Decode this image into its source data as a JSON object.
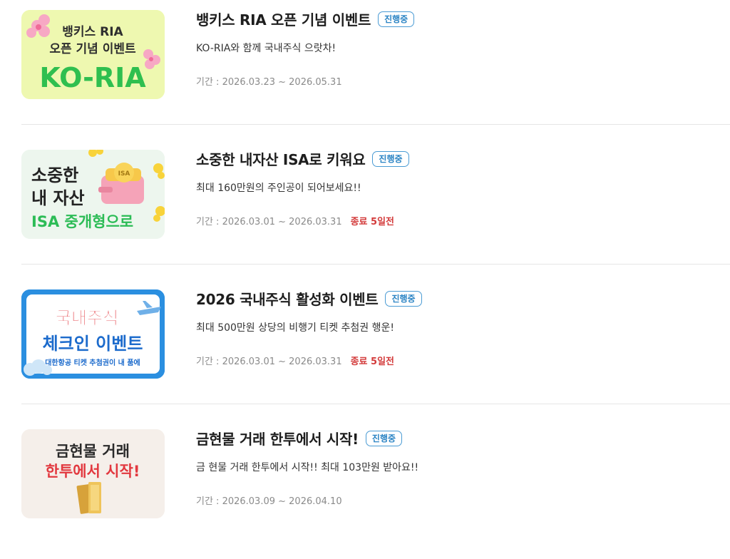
{
  "events": [
    {
      "title": "뱅키스 RIA 오픈 기념 이벤트",
      "badge": "진행중",
      "desc": "KO-RIA와 함께 국내주식 으랏차!",
      "period": "기간 : 2026.03.23 ~ 2026.05.31",
      "deadline": "",
      "thumb_lines": [
        "뱅키스 RIA",
        "오픈 기념 이벤트",
        "KO-RIA"
      ]
    },
    {
      "title": "소중한 내자산 ISA로 키워요",
      "badge": "진행중",
      "desc": "최대 160만원의 주인공이 되어보세요!!",
      "period": "기간 : 2026.03.01 ~ 2026.03.31",
      "deadline": "종료 5일전",
      "thumb_lines": [
        "소중한",
        "내 자산",
        "ISA 중개형으로",
        "ISA"
      ]
    },
    {
      "title": "2026 국내주식 활성화 이벤트",
      "badge": "진행중",
      "desc": "최대 500만원 상당의 비행기 티켓 추첨권 행운!",
      "period": "기간 : 2026.03.01 ~ 2026.03.31",
      "deadline": "종료 5일전",
      "thumb_lines": [
        "국내주식",
        "체크인 이벤트",
        "대한항공 티켓 추첨권이 내 품에"
      ]
    },
    {
      "title": "금현물 거래 한투에서 시작!",
      "badge": "진행중",
      "desc": "금 현물 거래 한투에서 시작!! 최대 103만원 받아요!!",
      "period": "기간 : 2026.03.09 ~ 2026.04.10",
      "deadline": "",
      "thumb_lines": [
        "금현물 거래",
        "한투에서 시작!"
      ]
    }
  ]
}
